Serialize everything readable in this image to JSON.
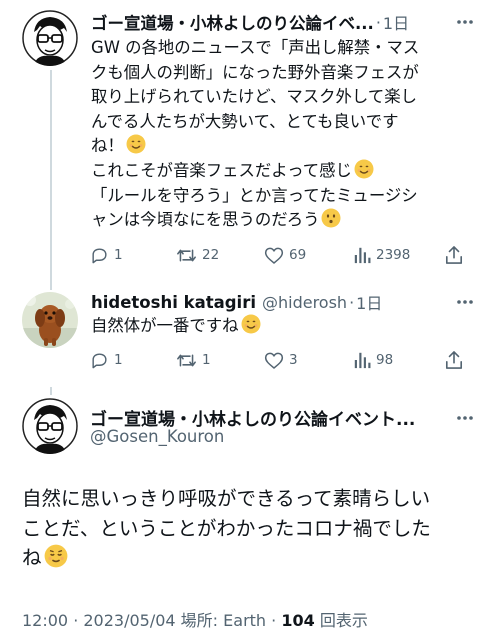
{
  "tweet1": {
    "author_name": "ゴー宣道場・小林よしのり公論イベ...",
    "dot": "·",
    "time": "1日",
    "lines": [
      "GW の各地のニュースで「声出し解禁・マス",
      "クも個人の判断」になった野外音楽フェスが",
      "取り上げられていたけど、マスク外して楽し",
      "んでる人たちが大勢いて、とても良いです",
      "ね！",
      "これこそが音楽フェスだよって感じ",
      "「ルールを守ろう」とか言ってたミュージシ",
      "ャンは今頃なにを思うのだろう"
    ],
    "emoji": {
      "line5": "smile",
      "line6": "smile",
      "line8": "neutral"
    },
    "actions": {
      "replies": "1",
      "retweets": "22",
      "likes": "69",
      "views": "2398"
    }
  },
  "tweet2": {
    "author_name": "hidetoshi katagiri",
    "handle": "@hiderosh",
    "dot": "·",
    "time": "1日",
    "text": "自然体が一番ですね",
    "actions": {
      "replies": "1",
      "retweets": "1",
      "likes": "3",
      "views": "98"
    }
  },
  "main_tweet": {
    "author_name": "ゴー宣道場・小林よしのり公論イベント...",
    "handle": "@Gosen_Kouron",
    "lines": [
      "自然に思いっきり呼吸ができるって素晴らしい",
      "ことだ、ということがわかったコロナ禍でした",
      "ね"
    ],
    "meta_time": "12:00 · 2023/05/04 場所: Earth ·",
    "meta_views": "104",
    "meta_views_label": "回表示"
  },
  "colors": {
    "text": "#0f1419",
    "secondary": "#536471",
    "thread_line": "#cfd9de",
    "emoji": "#f7c948"
  },
  "icons": [
    "more-icon",
    "reply-icon",
    "retweet-icon",
    "like-icon",
    "views-icon",
    "share-icon"
  ]
}
